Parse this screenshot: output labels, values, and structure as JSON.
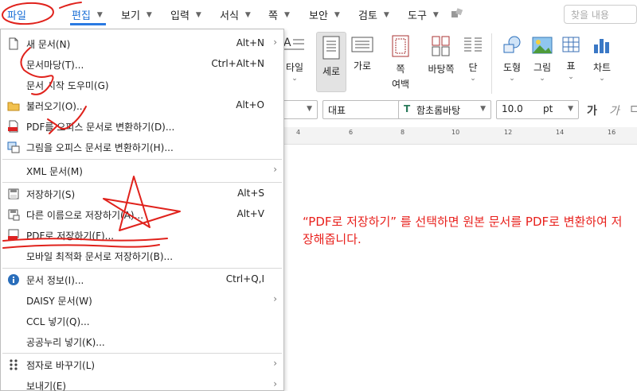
{
  "menubar": {
    "items": [
      {
        "label": "파일"
      },
      {
        "label": "편집"
      },
      {
        "label": "보기"
      },
      {
        "label": "입력"
      },
      {
        "label": "서식"
      },
      {
        "label": "쪽"
      },
      {
        "label": "보안"
      },
      {
        "label": "검토"
      },
      {
        "label": "도구"
      }
    ],
    "search_placeholder": "찾을 내용"
  },
  "ribbon": {
    "partial_label": "타일",
    "vertical_label": "세로",
    "horizontal_label": "가로",
    "page_margin_label": "쪽",
    "page_margin_sub": "여백",
    "page_bg_label": "바탕쪽",
    "column_label": "단",
    "shape_label": "도형",
    "picture_label": "그림",
    "table_label": "표",
    "chart_label": "차트"
  },
  "format": {
    "style_value": "대표",
    "font_value": "함초롬바탕",
    "size_value": "10.0",
    "size_unit": "pt",
    "bold_label": "가",
    "italic_label": "가"
  },
  "ruler": {
    "numbers": [
      "4",
      "6",
      "8",
      "10",
      "12",
      "14",
      "16",
      "18"
    ]
  },
  "dropdown": {
    "items": [
      {
        "label": "새 문서(N)",
        "shortcut": "Alt+N",
        "icon": "new-document-icon",
        "submenu": true
      },
      {
        "label": "문서마당(T)...",
        "shortcut": "Ctrl+Alt+N",
        "icon": "none"
      },
      {
        "label": "문서 시작 도우미(G)",
        "shortcut": "",
        "icon": "none"
      },
      {
        "label": "불러오기(O)...",
        "shortcut": "Alt+O",
        "icon": "folder-icon"
      },
      {
        "label": "PDF를 오피스 문서로 변환하기(D)...",
        "shortcut": "",
        "icon": "pdf-icon"
      },
      {
        "label": "그림을 오피스 문서로 변환하기(H)...",
        "shortcut": "",
        "icon": "image-convert-icon"
      },
      {
        "label": "XML 문서(M)",
        "shortcut": "",
        "icon": "none",
        "submenu": true
      },
      {
        "label": "저장하기(S)",
        "shortcut": "Alt+S",
        "icon": "save-icon"
      },
      {
        "label": "다른 이름으로 저장하기(A)...",
        "shortcut": "Alt+V",
        "icon": "save-as-icon"
      },
      {
        "label": "PDF로 저장하기(F)...",
        "shortcut": "",
        "icon": "pdf-save-icon"
      },
      {
        "label": "모바일 최적화 문서로 저장하기(B)...",
        "shortcut": "",
        "icon": "none"
      },
      {
        "label": "문서 정보(I)...",
        "shortcut": "Ctrl+Q,I",
        "icon": "info-icon"
      },
      {
        "label": "DAISY 문서(W)",
        "shortcut": "",
        "icon": "none",
        "submenu": true
      },
      {
        "label": "CCL 넣기(Q)...",
        "shortcut": "",
        "icon": "none"
      },
      {
        "label": "공공누리 넣기(K)...",
        "shortcut": "",
        "icon": "none"
      },
      {
        "label": "점자로 바꾸기(L)",
        "shortcut": "",
        "icon": "braille-icon",
        "submenu": true
      },
      {
        "label": "보내기(E)",
        "shortcut": "",
        "icon": "none",
        "submenu": true
      }
    ]
  },
  "annotation": {
    "text": "“PDF로 저장하기” 를 선택하면 원본 문서를 PDF로 변환하여 저장해줍니다."
  },
  "colors": {
    "accent": "#1a6fd6",
    "annotation": "#e8201c",
    "menu_border": "#bdbdbd"
  }
}
